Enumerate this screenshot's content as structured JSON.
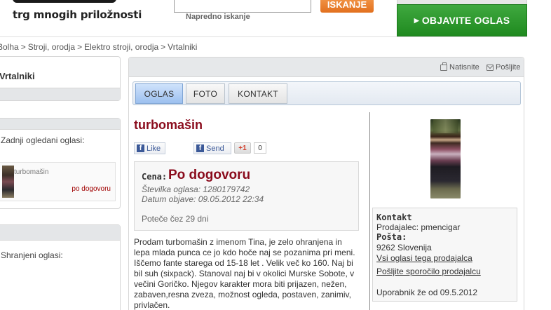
{
  "header": {
    "tagline": "trg mnogih priložnosti",
    "search": {
      "value": "",
      "placeholder": ""
    },
    "advanced_search_label": "Napredno iskanje",
    "search_button_label": "ISKANJE",
    "publish_button_label": "OBJAVITE OGLAS"
  },
  "breadcrumb": {
    "items": [
      "Bolha",
      "Stroji, orodja",
      "Elektro stroji, orodja",
      "Vrtalniki"
    ],
    "separator": ">"
  },
  "sidebar": {
    "category_title": "Vrtalniki",
    "recently_viewed_label": "Zadnji ogledani oglasi:",
    "recent_item": {
      "title": "turbomašin",
      "price": "po dogovoru"
    },
    "saved_label": "Shranjeni oglasi:"
  },
  "toolbar": {
    "print_label": "Natisnite",
    "send_label": "Pošljite"
  },
  "tabs": [
    {
      "label": "OGLAS",
      "active": true
    },
    {
      "label": "FOTO",
      "active": false
    },
    {
      "label": "KONTAKT",
      "active": false
    }
  ],
  "ad": {
    "title": "turbomašin",
    "social": {
      "like_label": "Like",
      "share_label": "Send",
      "gplus_label": "+1",
      "gplus_count": "0"
    },
    "price_label": "Cena:",
    "price_value": "Po dogovoru",
    "ad_number": "Številka oglasa: 1280179742",
    "publish_date": "Datum objave: 09.05.2012 22:34",
    "expires": "Poteče čez 29 dni",
    "description": "Prodam turbomašin z imenom Tina, je zelo ohranjena in lepa mlada punca ce jo kdo hoče naj se pozanima pri meni. Iščemo fante starega od 15-18 let . Velik več ko 160. Naj bi bil suh (sixpack). Stanoval naj bi v okolici Murske Sobote, v večini Goričko. Njegov karakter mora biti prijazen, nežen, zabaven,resna zveza, možnost ogleda, postaven, zanimiv, privlačen."
  },
  "contact": {
    "heading": "Kontakt",
    "seller_line": "Prodajalec: pmencigar",
    "post_label": "Pošta:",
    "post_value": "9262 Slovenija",
    "all_ads_link": "Vsi oglasi tega prodajalca",
    "message_link": "Pošljite sporočilo prodajalcu",
    "member_since": "Uporabnik že od 09.5.2012"
  },
  "colors": {
    "accent_red": "#8a0b1c",
    "publish_green": "#1f8a1f",
    "search_orange": "#e2701e",
    "active_tab_blue": "#9cc0ef"
  },
  "icons": [
    "printer-icon",
    "envelope-icon",
    "facebook-icon",
    "arrow-right-icon"
  ]
}
